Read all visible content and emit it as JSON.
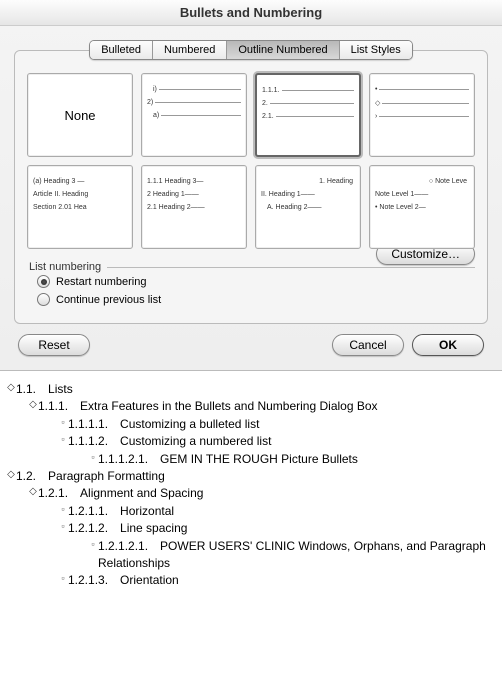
{
  "dialog": {
    "title": "Bullets and Numbering",
    "tabs": [
      "Bulleted",
      "Numbered",
      "Outline Numbered",
      "List Styles"
    ],
    "selected_tab": 2,
    "gallery": {
      "selected_index": 2,
      "items": [
        {
          "type": "none",
          "label": "None"
        },
        {
          "type": "preview",
          "lines": [
            "i)",
            "2)",
            "a)"
          ]
        },
        {
          "type": "preview",
          "lines": [
            "1.1.1.",
            "2.",
            "2.1."
          ]
        },
        {
          "type": "preview",
          "lines": [
            "•",
            "◇",
            "›"
          ]
        },
        {
          "type": "preview",
          "lines": [
            "(a) Heading 3 —",
            "Article II. Heading",
            "Section 2.01 Hea"
          ]
        },
        {
          "type": "preview",
          "lines": [
            "1.1.1 Heading 3—",
            "2 Heading 1——",
            "2.1 Heading 2——"
          ]
        },
        {
          "type": "preview",
          "lines": [
            "1. Heading",
            "II. Heading 1——",
            "A. Heading 2——"
          ]
        },
        {
          "type": "preview",
          "lines": [
            "○ Note Leve",
            "Note Level 1——",
            "• Note Level 2—"
          ]
        }
      ]
    },
    "list_numbering": {
      "label": "List numbering",
      "restart": "Restart numbering",
      "continue": "Continue previous list",
      "selected": "restart"
    },
    "customize": "Customize…",
    "buttons": {
      "reset": "Reset",
      "cancel": "Cancel",
      "ok": "OK"
    }
  },
  "outline": [
    {
      "level": 0,
      "handle": true,
      "num": "1.1.",
      "text": "Lists"
    },
    {
      "level": 1,
      "handle": true,
      "num": "1.1.1.",
      "text": "Extra Features in the Bullets and Numbering Dialog Box"
    },
    {
      "level": 2,
      "handle": false,
      "num": "1.1.1.1.",
      "text": "Customizing a bulleted list"
    },
    {
      "level": 2,
      "handle": false,
      "num": "1.1.1.2.",
      "text": "Customizing a numbered list"
    },
    {
      "level": 3,
      "handle": false,
      "num": "1.1.1.2.1.",
      "text": "GEM IN THE ROUGH Picture Bullets"
    },
    {
      "level": 0,
      "handle": true,
      "num": "1.2.",
      "text": "Paragraph Formatting"
    },
    {
      "level": 1,
      "handle": true,
      "num": "1.2.1.",
      "text": "Alignment and Spacing"
    },
    {
      "level": 2,
      "handle": false,
      "num": "1.2.1.1.",
      "text": "Horizontal"
    },
    {
      "level": 2,
      "handle": false,
      "num": "1.2.1.2.",
      "text": "Line spacing"
    },
    {
      "level": 3,
      "handle": false,
      "num": "1.2.1.2.1.",
      "text": "POWER USERS' CLINIC Windows, Orphans, and Paragraph Relationships"
    },
    {
      "level": 2,
      "handle": false,
      "num": "1.2.1.3.",
      "text": "Orientation"
    }
  ]
}
